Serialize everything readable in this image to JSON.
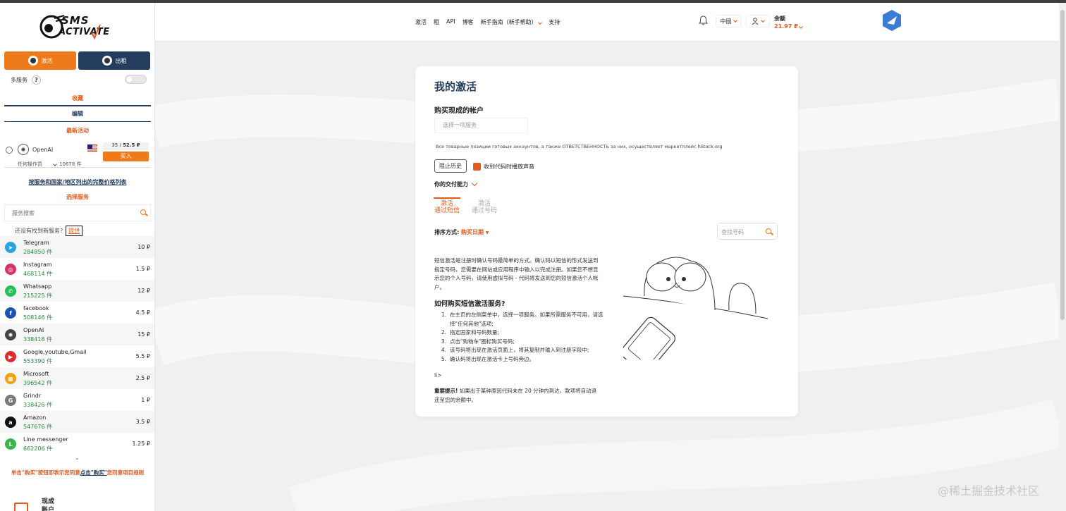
{
  "sidebar": {
    "logo": {
      "line1": "SMS",
      "line2": "ACTIVATE"
    },
    "activate_label": "激活",
    "rent_label": "出租",
    "multi_label": "多服务",
    "multi_help": "?",
    "favorites": "收藏",
    "edit": "编辑",
    "recent_title": "最新活动",
    "recent": {
      "name": "OpenAI",
      "price_count": "35",
      "price_value": "52.5 ₽",
      "buy": "买入",
      "operator": "任何操作员",
      "count": "10678 件"
    },
    "price_list_link": "按服务和国家/地区列出的完整价格列表",
    "select_title": "选择服务",
    "search_placeholder": "服务搜索",
    "not_found": "还没有找到新服务?",
    "suggest": "提供",
    "services": [
      {
        "name": "Telegram",
        "count": "284850 件",
        "price": "10 ₽",
        "color": "#2aa3de",
        "glyph": "➤"
      },
      {
        "name": "Instagram",
        "count": "468114 件",
        "price": "1.5 ₽",
        "color": "#d6336c",
        "glyph": "◎"
      },
      {
        "name": "Whatsapp",
        "count": "215225 件",
        "price": "12 ₽",
        "color": "#25c05a",
        "glyph": "✆"
      },
      {
        "name": "facebook",
        "count": "508146 件",
        "price": "4.5 ₽",
        "color": "#1a55b5",
        "glyph": "f"
      },
      {
        "name": "OpenAI",
        "count": "338418 件",
        "price": "15 ₽",
        "color": "#444444",
        "glyph": "✺"
      },
      {
        "name": "Google,youtube,Gmail",
        "count": "553390 件",
        "price": "5.5 ₽",
        "color": "#e02b2b",
        "glyph": "▶"
      },
      {
        "name": "Microsoft",
        "count": "396542 件",
        "price": "2.5 ₽",
        "color": "#f0a010",
        "glyph": "▦"
      },
      {
        "name": "Grindr",
        "count": "338426 件",
        "price": "1 ₽",
        "color": "#777777",
        "glyph": "G"
      },
      {
        "name": "Amazon",
        "count": "547676 件",
        "price": "3.5 ₽",
        "color": "#111111",
        "glyph": "a"
      },
      {
        "name": "Line messenger",
        "count": "662206 件",
        "price": "1.25 ₽",
        "color": "#3ab54a",
        "glyph": "L"
      }
    ],
    "more": "⌄",
    "rules_prefix": "单击\"购买\"按钮即表示您同意",
    "rules_link": "点击\"购买\"",
    "rules_suffix": "您同意项目规则",
    "bottom_line1": "现成",
    "bottom_line2": "账户"
  },
  "header": {
    "nav": [
      "激活",
      "租",
      "API",
      "博客",
      "新手指南（新手帮助）",
      "支持"
    ],
    "lang": "中國",
    "balance_label": "余额",
    "balance_value": "21.97 ₽"
  },
  "card": {
    "title": "我的激活",
    "ready_title": "购买现成的帐户",
    "select_placeholder": "选择一项服务",
    "disclaimer": "Все товарные позиции готовых аккаунтов, а также ОТВЕТСТВЕННОСТЬ за них, осуществляет маркетплейс",
    "disclaimer_link": "hStock.org",
    "history_btn": "阻止历史",
    "sound_label": "收到代码时播放声音",
    "delivery": "你的交付能力",
    "tab_sms_1": "激活",
    "tab_sms_2": "通过短信",
    "tab_num_1": "激活",
    "tab_num_2": "通过号码",
    "sort_label": "排序方式:",
    "sort_value": "购买日期",
    "number_search": "查找号码",
    "description": "短信激活是注册时确认号码最简单的方式。确认码以短信的形式发送到指定号码，您需要在网站或应用程序中输入以完成注册。如果您不想显示您的个人号码，请使用虚拟号码 - 代码将发送到您的短信激活个人帐户。",
    "howto_title": "如何购买短信激活服务?",
    "steps": [
      {
        "n": "1.",
        "t": "在主页的左侧菜单中，选择一项服务。如果所需服务不可用，请选择\"任何其他\"选项;"
      },
      {
        "n": "2.",
        "t": "指定国家和号码数量;"
      },
      {
        "n": "3.",
        "t": "点击\"购物车\"图标购买号码;"
      },
      {
        "n": "4.",
        "t": "该号码将出现在激活页面上，将其复制并输入到注册字段中;"
      },
      {
        "n": "5.",
        "t": "确认码将出现在激活卡上号码旁边。"
      }
    ],
    "li_tag": "li>",
    "important_label": "重要提示!",
    "important_text": "如果出于某种原因代码未在 20 分钟内到达，款项将自动退还至您的余额中。"
  },
  "watermark": "@稀土掘金技术社区"
}
